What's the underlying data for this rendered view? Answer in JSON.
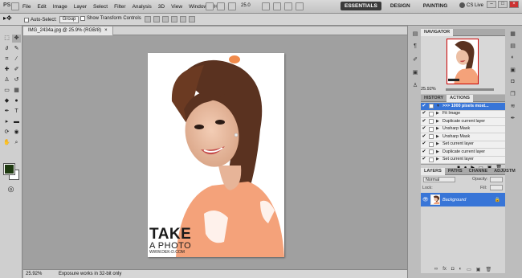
{
  "app": {
    "logo": "PS"
  },
  "menu": [
    "File",
    "Edit",
    "Image",
    "Layer",
    "Select",
    "Filter",
    "Analysis",
    "3D",
    "View",
    "Window",
    "Help"
  ],
  "menubar": {
    "zoom": "25.0"
  },
  "workspace": {
    "essentials": "ESSENTIALS",
    "design": "DESIGN",
    "painting": "PAINTING",
    "more": "»"
  },
  "cslive": {
    "label": "CS Live"
  },
  "options": {
    "auto_select_label": "Auto-Select:",
    "auto_select_value": "Group",
    "transform_label": "Show Transform Controls"
  },
  "document": {
    "tab_title": "IMG_2434a.jpg @ 25.9% (RGB/8)",
    "tab_close": "×"
  },
  "photo": {
    "brand_line1": "TAKE",
    "brand_line2": "A PHOTO",
    "brand_url": "WWW.DEK-D.COM"
  },
  "status": {
    "zoom": "25.92%",
    "message": "Exposure works in 32-bit only"
  },
  "navigator": {
    "tab": "NAVIGATOR",
    "zoom": "25.92%"
  },
  "history_tabs": {
    "history": "HISTORY",
    "actions": "ACTIONS"
  },
  "actions": [
    {
      "label": ">>> 1000 pixels most...",
      "highlight": true
    },
    {
      "label": "Fit Image",
      "highlight": false
    },
    {
      "label": "Duplicate current layer",
      "highlight": false
    },
    {
      "label": "Unsharp Mask",
      "highlight": false
    },
    {
      "label": "Unsharp Mask",
      "highlight": false
    },
    {
      "label": "Set current layer",
      "highlight": false
    },
    {
      "label": "Duplicate current layer",
      "highlight": false
    },
    {
      "label": "Set current layer",
      "highlight": false
    }
  ],
  "layers_tabs": {
    "layers": "LAYERS",
    "paths": "PATHS",
    "channels": "CHANNE",
    "adjust": "ADJUSTM"
  },
  "layers": {
    "blend_mode": "Normal",
    "opacity_label": "Opacity:",
    "fill_label": "Fill:",
    "lock_label": "Lock:",
    "layer_name": "Background"
  },
  "colors": {
    "fg": "#1e3a10",
    "bg": "#ffffff",
    "accent": "#3875d7",
    "skin": "#f4a27a"
  }
}
